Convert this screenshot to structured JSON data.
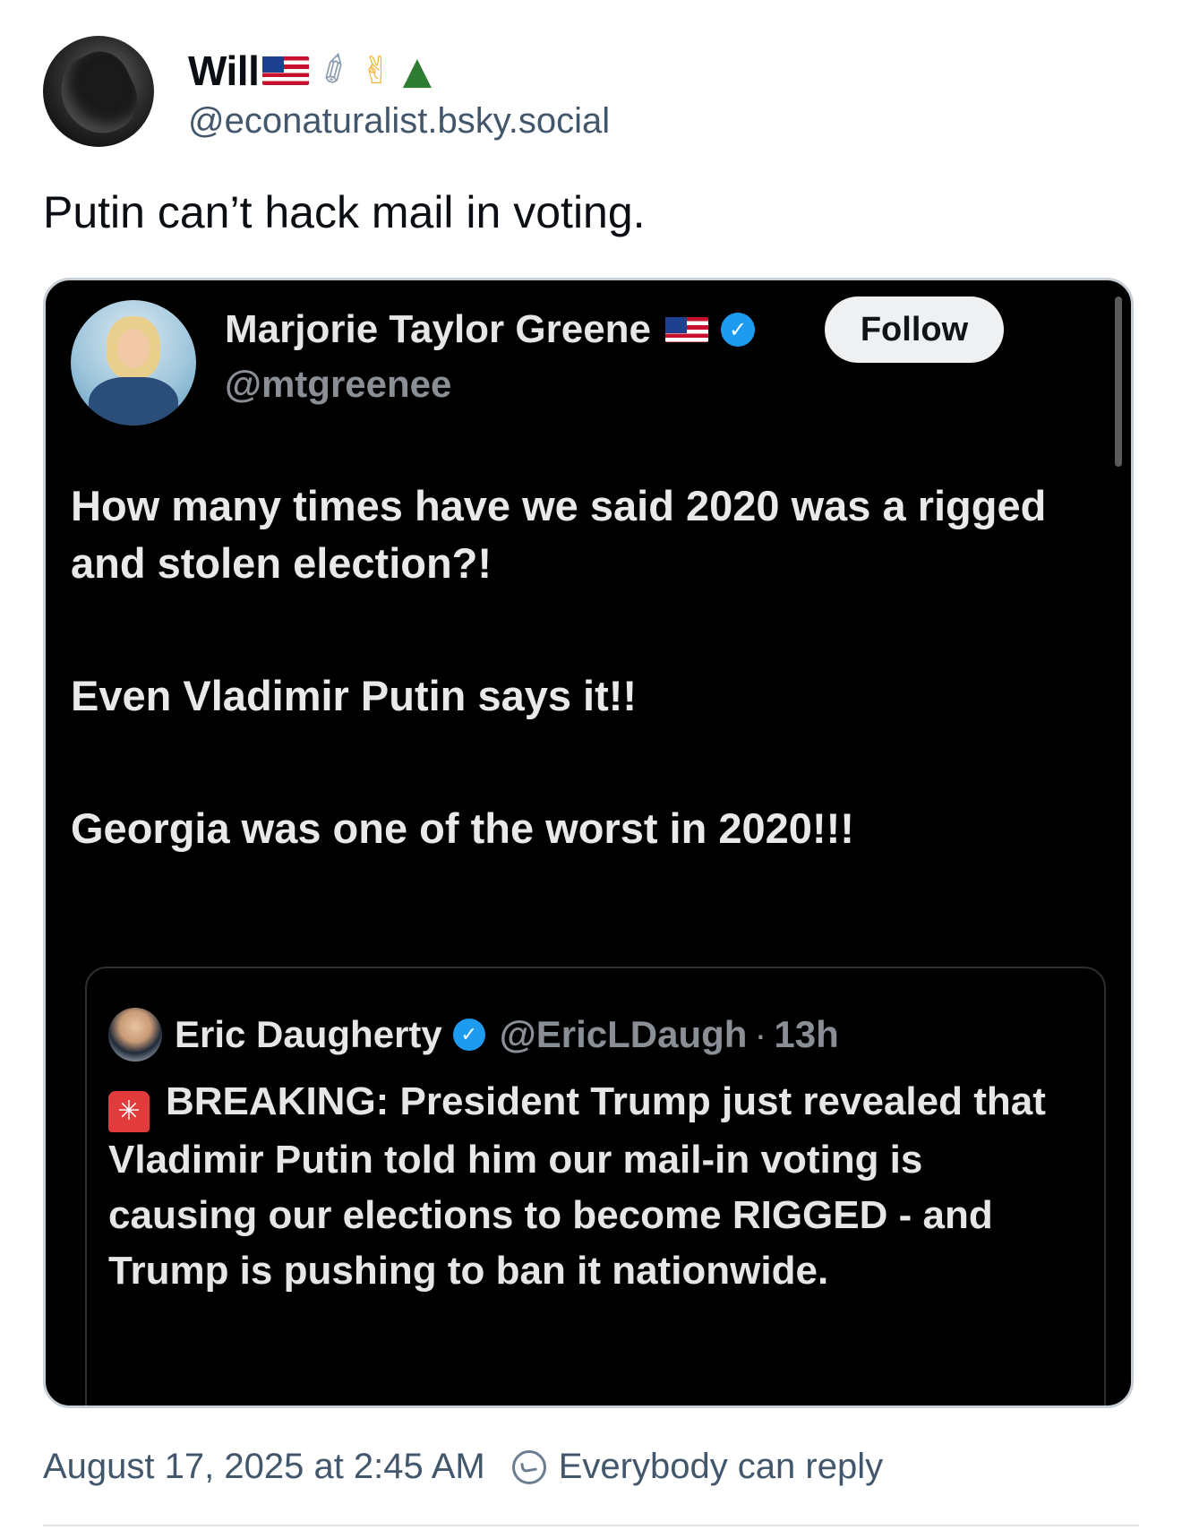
{
  "post": {
    "author": {
      "display_name": "Will",
      "name_emoji": [
        "flag-us-icon",
        "paperclip-icon",
        "victory-hand-icon",
        "evergreen-tree-icon"
      ],
      "handle": "@econaturalist.bsky.social"
    },
    "text": "Putin can’t hack mail in voting.",
    "embed": {
      "author": {
        "name": "Marjorie Taylor Greene",
        "handle": "@mtgreenee",
        "verified": true
      },
      "follow_label": "Follow",
      "paragraphs": [
        "How many times have we said 2020 was a rigged and stolen election?!",
        "Even Vladimir Putin says it!!",
        "Georgia was one of the worst in 2020!!!"
      ],
      "quote": {
        "name": "Eric Daugherty",
        "handle": "@EricLDaugh",
        "separator": "·",
        "time": "13h",
        "text": "BREAKING: President Trump just revealed that Vladimir Putin told him our mail-in voting is causing our elections to become RIGGED - and Trump is pushing to ban it nationwide."
      }
    },
    "timestamp": "August 17, 2025 at 2:45 AM",
    "reply_setting": "Everybody can reply"
  },
  "colors": {
    "handle_gray": "#42576c",
    "verified_blue": "#1d9bf0",
    "embed_background": "#000000"
  }
}
